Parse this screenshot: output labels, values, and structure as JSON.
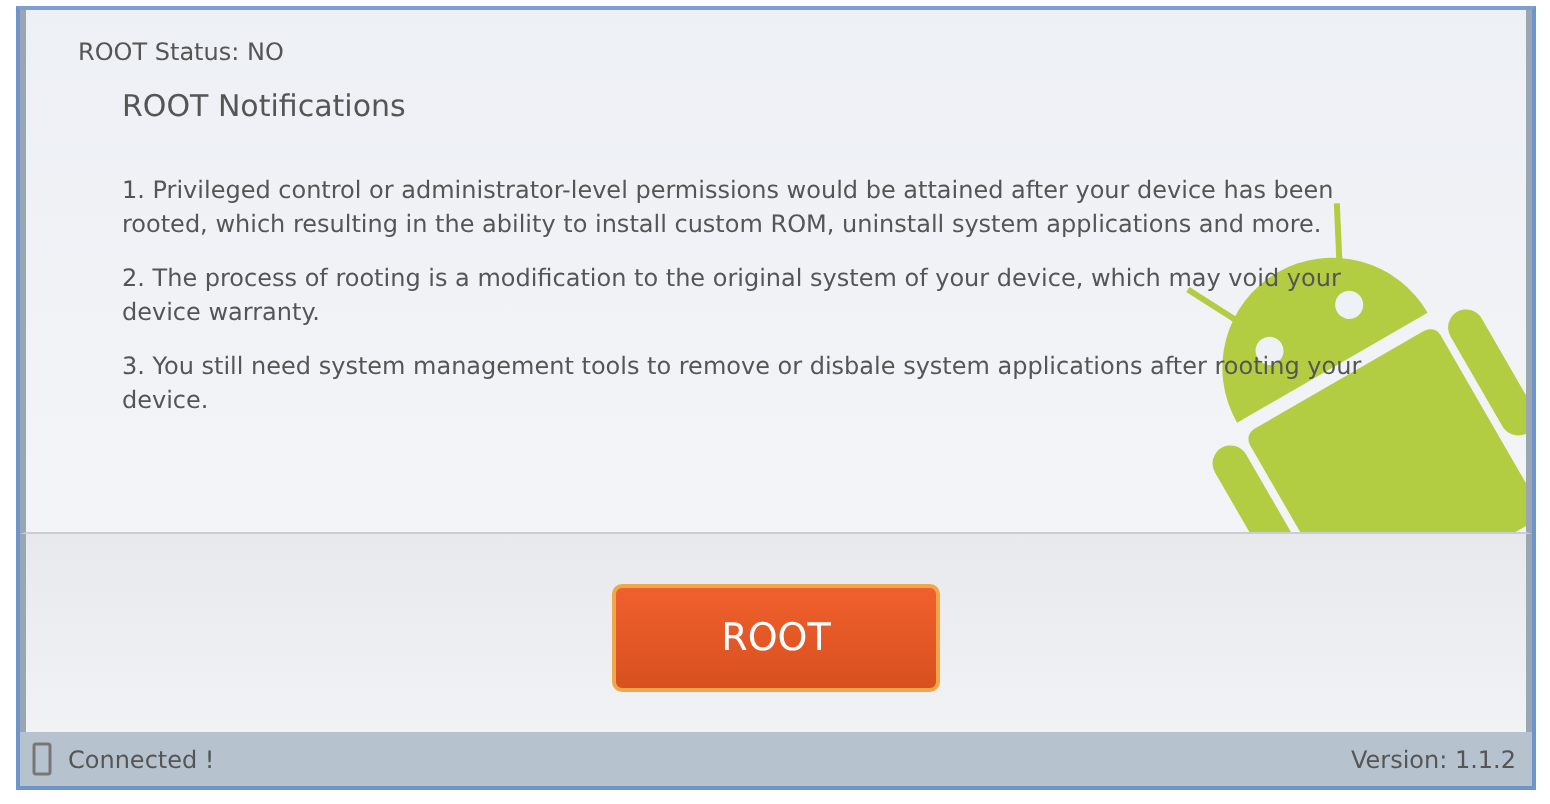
{
  "status": {
    "label": "ROOT Status: NO"
  },
  "notifications": {
    "title": "ROOT Notifications",
    "items": [
      "1. Privileged control or administrator-level permissions would be attained after your device has been rooted, which resulting in the ability to install custom ROM, uninstall system applications and more.",
      "2. The process of rooting is a modification to the original system of your device, which may void your device warranty.",
      "3. You still need system management tools to remove or disbale system applications after rooting your device."
    ]
  },
  "action": {
    "label": "ROOT"
  },
  "status_bar": {
    "connection": "Connected !",
    "version": "Version: 1.1.2"
  }
}
